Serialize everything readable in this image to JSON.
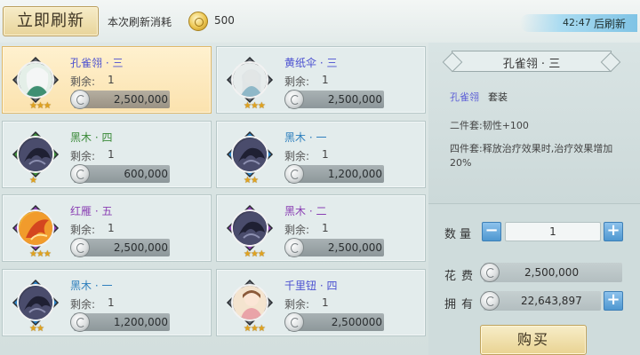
{
  "topbar": {
    "refresh_label": "立即刷新",
    "cost_label": "本次刷新消耗",
    "cost_value": "500",
    "timer_value": "42:47",
    "timer_suffix": "后刷新"
  },
  "items": [
    {
      "name": "孔雀翎 · 三",
      "name_color": "#4a4fd0",
      "remain_label": "剩余:",
      "remain": "1",
      "price": "2,500,000",
      "stars": "★★★",
      "frame_color": "#6a7077",
      "selected": true,
      "portrait": "peacock-spirit-portrait"
    },
    {
      "name": "黄纸伞 · 三",
      "name_color": "#4a4fd0",
      "remain_label": "剩余:",
      "remain": "1",
      "price": "2,500,000",
      "stars": "★★★",
      "frame_color": "#6a7077",
      "selected": false,
      "portrait": "umbrella-spirit-portrait"
    },
    {
      "name": "黑木 · 四",
      "name_color": "#3b8a39",
      "remain_label": "剩余:",
      "remain": "1",
      "price": "600,000",
      "stars": "★",
      "frame_color": "#3f8f3c",
      "selected": false,
      "portrait": "crow-portrait"
    },
    {
      "name": "黑木 · 一",
      "name_color": "#2e7fbd",
      "remain_label": "剩余:",
      "remain": "1",
      "price": "1,200,000",
      "stars": "★★",
      "frame_color": "#2f86c8",
      "selected": false,
      "portrait": "crow-portrait"
    },
    {
      "name": "红雁 · 五",
      "name_color": "#8a3fb3",
      "remain_label": "剩余:",
      "remain": "1",
      "price": "2,500,000",
      "stars": "★★★",
      "frame_color": "#8e44b5",
      "selected": false,
      "portrait": "phoenix-portrait"
    },
    {
      "name": "黑木 · 二",
      "name_color": "#8a3fb3",
      "remain_label": "剩余:",
      "remain": "1",
      "price": "2,500,000",
      "stars": "★★★",
      "frame_color": "#8e44b5",
      "selected": false,
      "portrait": "crow-portrait"
    },
    {
      "name": "黑木 · 一",
      "name_color": "#2e7fbd",
      "remain_label": "剩余:",
      "remain": "1",
      "price": "1,200,000",
      "stars": "★★",
      "frame_color": "#2f86c8",
      "selected": false,
      "portrait": "crow-portrait"
    },
    {
      "name": "千里钮 · 四",
      "name_color": "#4a4fd0",
      "remain_label": "剩余:",
      "remain": "1",
      "price": "2,500000",
      "stars": "★★★",
      "frame_color": "#6a7077",
      "selected": false,
      "portrait": "girl-portrait"
    }
  ],
  "detail": {
    "title": "孔雀翎 · 三",
    "set_name": "孔雀翎",
    "set_suffix": "套装",
    "two_set": "二件套:韧性+100",
    "four_set": "四件套:释放治疗效果时,治疗效果增加20%"
  },
  "purchase": {
    "qty_label": "数量",
    "qty_value": "1",
    "cost_label": "花费",
    "cost_value": "2,500,000",
    "own_label": "拥有",
    "own_value": "22,643,897",
    "buy_label": "购买"
  },
  "colors": {
    "accent_blue": "#4e97d0",
    "gold_button": "#e9d392",
    "selected_card": "#fbe2ae"
  }
}
